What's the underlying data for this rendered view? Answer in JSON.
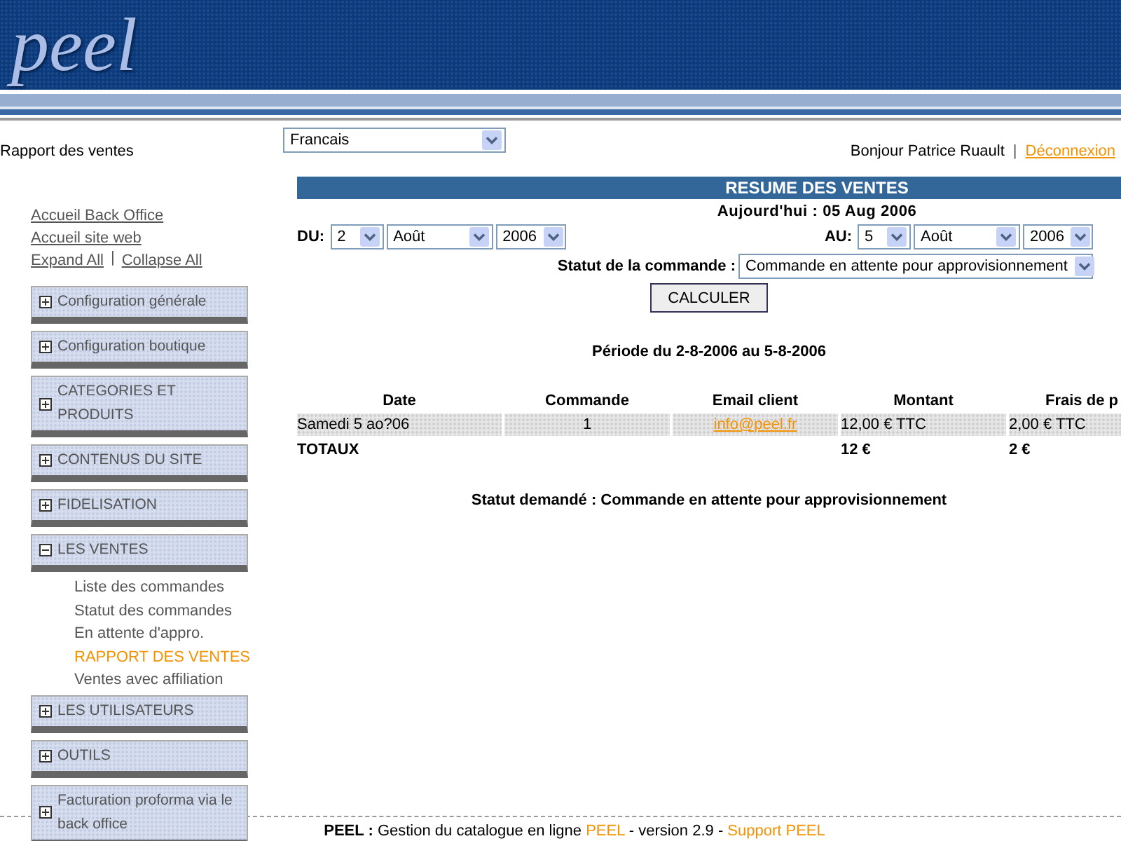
{
  "header": {
    "logo": "peel"
  },
  "page_title": "Rapport des ventes",
  "language_select": {
    "value": "Francais"
  },
  "user_bar": {
    "greeting": "Bonjour Patrice Ruault",
    "separator": "|",
    "logout": "Déconnexion"
  },
  "sidebar": {
    "links": [
      "Accueil Back Office",
      "Accueil site web"
    ],
    "expand": "Expand All",
    "separator": "|",
    "collapse": "Collapse All",
    "sections": [
      {
        "label": "Configuration générale",
        "expanded": false
      },
      {
        "label": "Configuration boutique",
        "expanded": false
      },
      {
        "label": "CATEGORIES ET PRODUITS",
        "expanded": false
      },
      {
        "label": "CONTENUS DU SITE",
        "expanded": false
      },
      {
        "label": "FIDELISATION",
        "expanded": false
      },
      {
        "label": "LES VENTES",
        "expanded": true,
        "children": [
          {
            "label": "Liste des commandes",
            "selected": false
          },
          {
            "label": "Statut des commandes",
            "selected": false
          },
          {
            "label": "En attente d'appro.",
            "selected": false
          },
          {
            "label": "RAPPORT DES VENTES",
            "selected": true
          },
          {
            "label": "Ventes avec affiliation",
            "selected": false
          }
        ]
      },
      {
        "label": "LES UTILISATEURS",
        "expanded": false
      },
      {
        "label": "OUTILS",
        "expanded": false
      },
      {
        "label": "Facturation proforma via le back office",
        "expanded": false
      }
    ]
  },
  "report": {
    "title": "RESUME DES VENTES",
    "today": "Aujourd'hui : 05 Aug 2006",
    "from": {
      "label": "DU:",
      "day": "2",
      "month": "Août",
      "year": "2006"
    },
    "to": {
      "label": "AU:",
      "day": "5",
      "month": "Août",
      "year": "2006"
    },
    "status": {
      "label": "Statut de la commande :",
      "value": "Commande en attente pour approvisionnement"
    },
    "button": "CALCULER",
    "period": "Période du 2-8-2006 au 5-8-2006",
    "table": {
      "columns": [
        "Date",
        "Commande",
        "Email client",
        "Montant",
        "Frais de p"
      ],
      "rows": [
        {
          "date": "Samedi 5 ao?06",
          "order": "1",
          "email": "info@peel.fr",
          "amount": "12,00 € TTC",
          "shipping": "2,00 € TTC"
        }
      ],
      "totals": {
        "label": "TOTAUX",
        "amount": "12 €",
        "shipping": "2 €"
      }
    },
    "status_requested": "Statut demandé : Commande en attente pour approvisionnement"
  },
  "footer": {
    "parts": [
      {
        "kind": "bold",
        "text": "PEEL :"
      },
      {
        "kind": "text",
        "text": "Gestion du catalogue en ligne"
      },
      {
        "kind": "link",
        "text": "PEEL"
      },
      {
        "kind": "text",
        "text": "- version 2.9 -"
      },
      {
        "kind": "link",
        "text": "Support PEEL"
      }
    ]
  }
}
